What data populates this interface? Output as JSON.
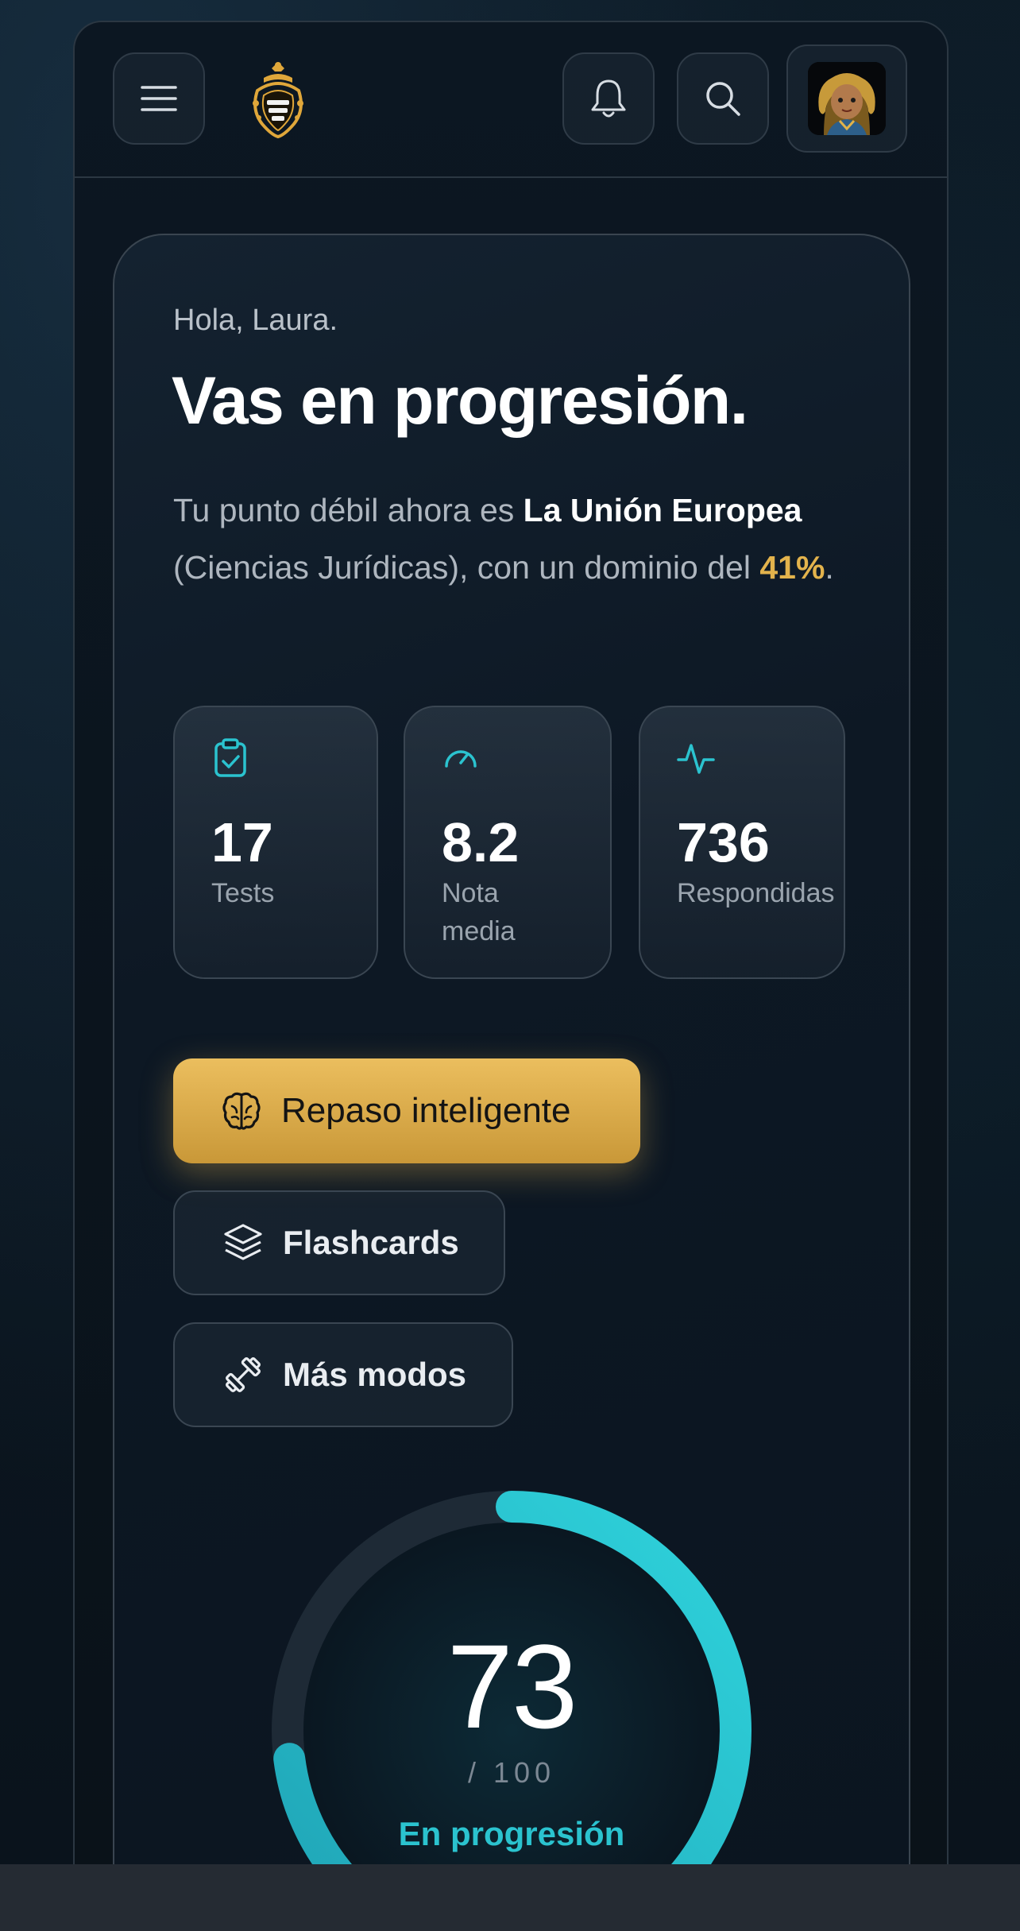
{
  "header": {
    "menu_icon": "hamburger-menu-icon",
    "logo_icon": "police-badge-logo",
    "bell_icon": "bell-icon",
    "search_icon": "search-icon",
    "avatar": "user-avatar"
  },
  "hero": {
    "greeting": "Hola, Laura.",
    "title": "Vas en progresión.",
    "desc_prefix": "Tu punto débil ahora es ",
    "weak_topic": "La Unión Europea",
    "desc_middle": " (Ciencias Jurídicas), con un dominio del ",
    "weak_percent": "41%",
    "desc_suffix": "."
  },
  "stats": [
    {
      "icon": "clipboard-check-icon",
      "value": "17",
      "label": "Tests"
    },
    {
      "icon": "gauge-icon",
      "value": "8.2",
      "label": "Nota media"
    },
    {
      "icon": "activity-pulse-icon",
      "value": "736",
      "label": "Respondidas"
    }
  ],
  "actions": {
    "primary": {
      "icon": "brain-icon",
      "label": "Repaso inteligente"
    },
    "flashcards": {
      "icon": "layers-icon",
      "label": "Flashcards"
    },
    "more": {
      "icon": "dumbbell-icon",
      "label": "Más modos"
    }
  },
  "score": {
    "value": "73",
    "max_label": "/ 100",
    "progress": 0.73,
    "status": "En progresión"
  },
  "colors": {
    "accent_gold": "#e3b34c",
    "accent_teal": "#2bc3cf",
    "background": "#0c1620"
  }
}
